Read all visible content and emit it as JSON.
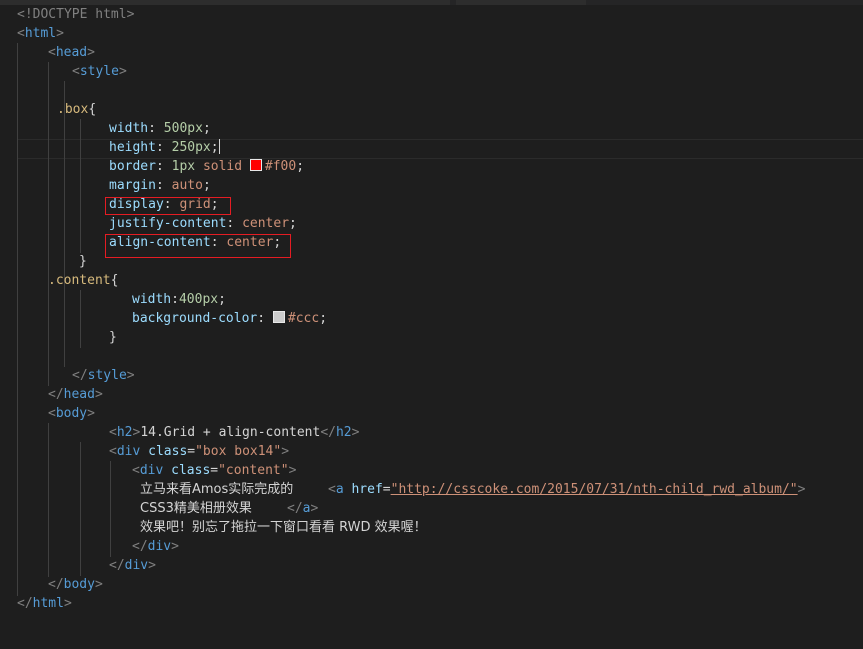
{
  "code": {
    "doctype": "<!DOCTYPE html>",
    "t_html": "html",
    "t_head": "head",
    "t_style": "style",
    "box_selector": ".box",
    "p_width": "width",
    "v_500": "500px",
    "p_height": "height",
    "v_250": "250px",
    "p_border": "border",
    "v_1px": "1px",
    "v_solid": "solid",
    "v_f00": "#f00",
    "p_margin": "margin",
    "v_auto": "auto",
    "p_display": "display",
    "v_grid": "grid",
    "p_justify": "justify-content",
    "v_center": "center",
    "p_align": "align-content",
    "content_selector": ".content",
    "v_400": "400px",
    "p_bg": "background-color",
    "v_ccc": "#ccc",
    "t_body": "body",
    "t_h2": "h2",
    "h2_text": "14.Grid + align-content",
    "t_div": "div",
    "a_class": "class",
    "s_box14": "\"box box14\"",
    "s_content": "\"content\"",
    "text_line1": "立马来看Amos实际完成的",
    "t_a": "a",
    "a_href": "href",
    "s_url": "\"http://csscoke.com/2015/07/31/nth-child_rwd_album/\"",
    "text_line2": "CSS3精美相册效果",
    "text_line3": "效果吧！别忘了拖拉一下窗口看看 RWD 效果喔！"
  },
  "colors": {
    "background": "#1e1e1e",
    "tag": "#569cd6",
    "punctuation": "#808080",
    "selector": "#d7ba7d",
    "property": "#9cdcfe",
    "string_value": "#ce9178",
    "number": "#b5cea8",
    "highlight_box": "#e51c23",
    "swatch_red": "#ff0000",
    "swatch_gray": "#cccccc"
  }
}
